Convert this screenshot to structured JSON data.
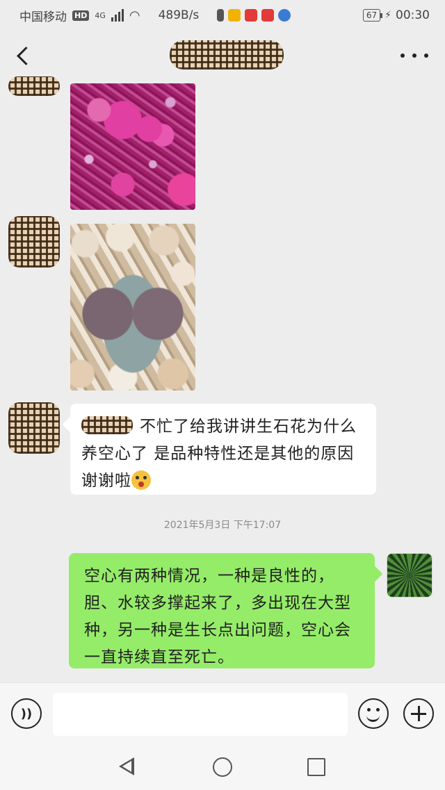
{
  "status_bar": {
    "carrier": "中国移动",
    "network_badge": "HD",
    "network_type": "4G",
    "speed": "489B/s",
    "battery": "67",
    "time": "00:30",
    "notification_icons": [
      "sim-alert-icon",
      "mail-icon",
      "app-icon",
      "app-icon",
      "music-icon"
    ]
  },
  "header": {
    "back_icon": "chevron-left-icon",
    "more_icon": "more-dots-icon"
  },
  "messages": {
    "incoming_text": "不忙了给我讲讲生石花为什么养空心了 是品种特性还是其他的原因 谢谢啦",
    "timestamp": "2021年5月3日 下午17:07",
    "outgoing_text": "空心有两种情况，一种是良性的，胆、水较多撑起来了，多出现在大型种，另一种是生长点出问题，空心会一直持续直至死亡。"
  },
  "input_bar": {
    "value": "",
    "voice_icon": "voice-icon",
    "emoji_icon": "emoji-icon",
    "plus_icon": "plus-icon"
  },
  "colors": {
    "background": "#ededed",
    "outgoing_bubble": "#95ec69",
    "incoming_bubble": "#ffffff"
  }
}
